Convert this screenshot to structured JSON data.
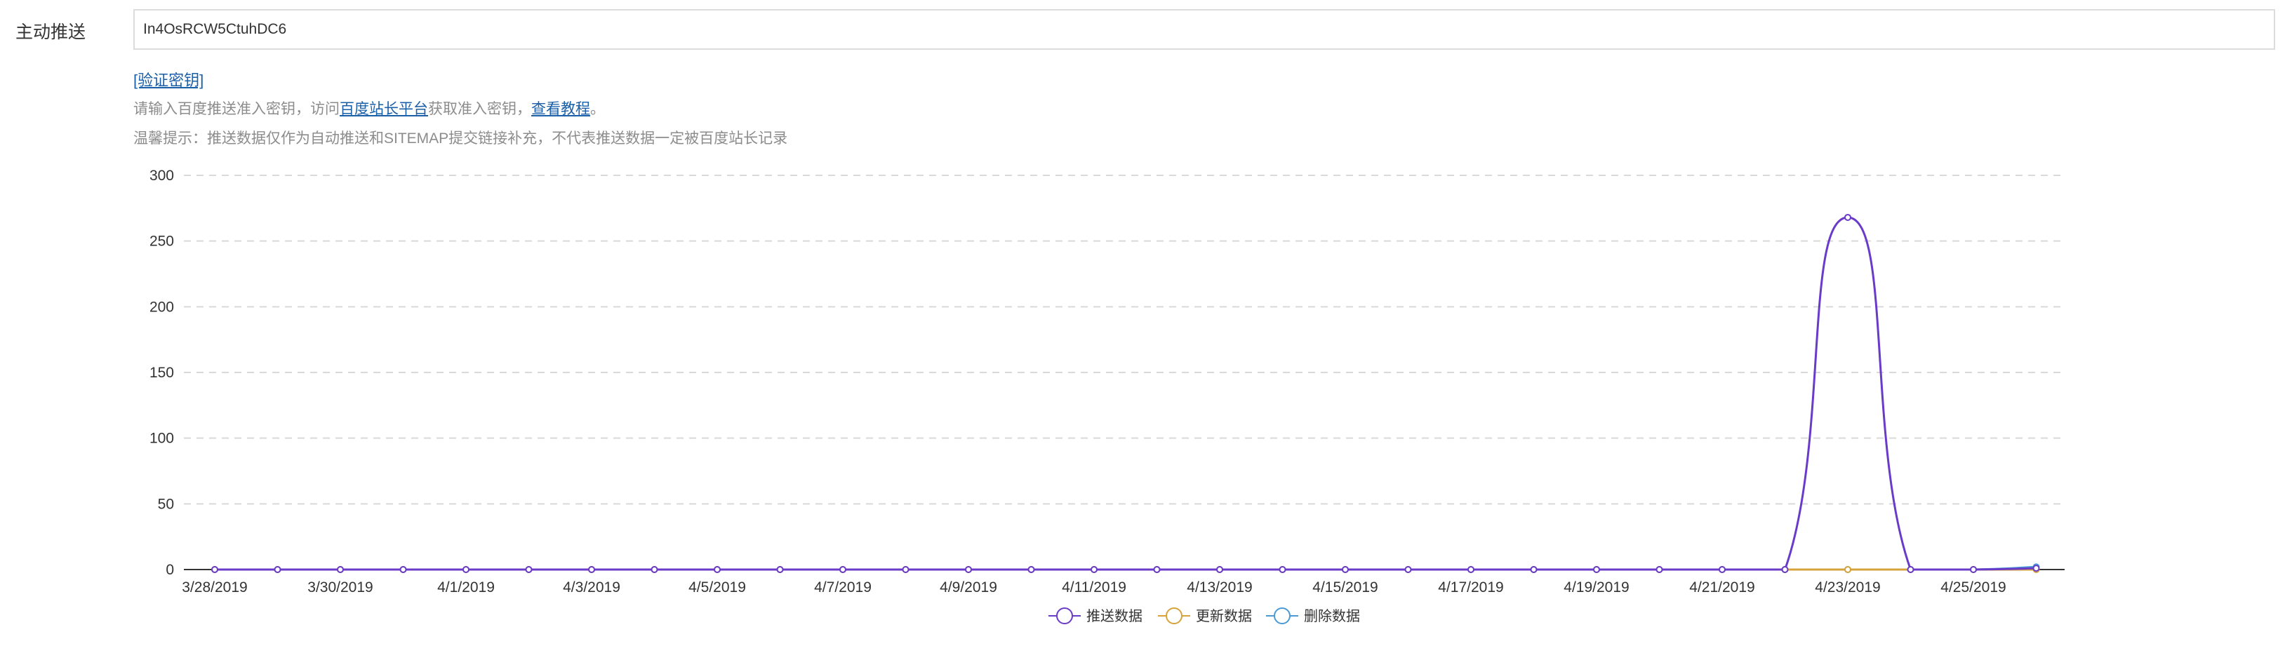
{
  "form": {
    "label": "主动推送",
    "key_value": "In4OsRCW5CtuhDC6",
    "verify_link": "[验证密钥]",
    "help1_prefix": "请输入百度推送准入密钥，访问",
    "help1_link1": "百度站长平台",
    "help1_middle": "获取准入密钥，",
    "help1_link2": "查看教程",
    "help1_suffix": "。",
    "help2": "温馨提示：推送数据仅作为自动推送和SITEMAP提交链接补充，不代表推送数据一定被百度站长记录"
  },
  "chart_data": {
    "type": "line",
    "x": [
      "3/28/2019",
      "3/29/2019",
      "3/30/2019",
      "3/31/2019",
      "4/1/2019",
      "4/2/2019",
      "4/3/2019",
      "4/4/2019",
      "4/5/2019",
      "4/6/2019",
      "4/7/2019",
      "4/8/2019",
      "4/9/2019",
      "4/10/2019",
      "4/11/2019",
      "4/12/2019",
      "4/13/2019",
      "4/14/2019",
      "4/15/2019",
      "4/16/2019",
      "4/17/2019",
      "4/18/2019",
      "4/19/2019",
      "4/20/2019",
      "4/21/2019",
      "4/22/2019",
      "4/23/2019",
      "4/24/2019",
      "4/25/2019",
      "4/26/2019"
    ],
    "x_tick_labels": [
      "3/28/2019",
      "3/30/2019",
      "4/1/2019",
      "4/3/2019",
      "4/5/2019",
      "4/7/2019",
      "4/9/2019",
      "4/11/2019",
      "4/13/2019",
      "4/15/2019",
      "4/17/2019",
      "4/19/2019",
      "4/21/2019",
      "4/23/2019",
      "4/25/2019"
    ],
    "y_ticks": [
      0,
      50,
      100,
      150,
      200,
      250,
      300
    ],
    "ylim": [
      0,
      300
    ],
    "grid": true,
    "legend_position": "bottom-center",
    "series": [
      {
        "name": "推送数据",
        "color": "#6a3bc9",
        "values": [
          0,
          0,
          0,
          0,
          0,
          0,
          0,
          0,
          0,
          0,
          0,
          0,
          0,
          0,
          0,
          0,
          0,
          0,
          0,
          0,
          0,
          0,
          0,
          0,
          0,
          0,
          268,
          0,
          0,
          1
        ]
      },
      {
        "name": "更新数据",
        "color": "#d6a23a",
        "values": [
          0,
          0,
          0,
          0,
          0,
          0,
          0,
          0,
          0,
          0,
          0,
          0,
          0,
          0,
          0,
          0,
          0,
          0,
          0,
          0,
          0,
          0,
          0,
          0,
          0,
          0,
          0,
          0,
          0,
          0
        ]
      },
      {
        "name": "删除数据",
        "color": "#4a9ad4",
        "values": [
          0,
          0,
          0,
          0,
          0,
          0,
          0,
          0,
          0,
          0,
          0,
          0,
          0,
          0,
          0,
          0,
          0,
          0,
          0,
          0,
          0,
          0,
          0,
          0,
          0,
          0,
          0,
          0,
          0,
          2
        ]
      }
    ]
  }
}
